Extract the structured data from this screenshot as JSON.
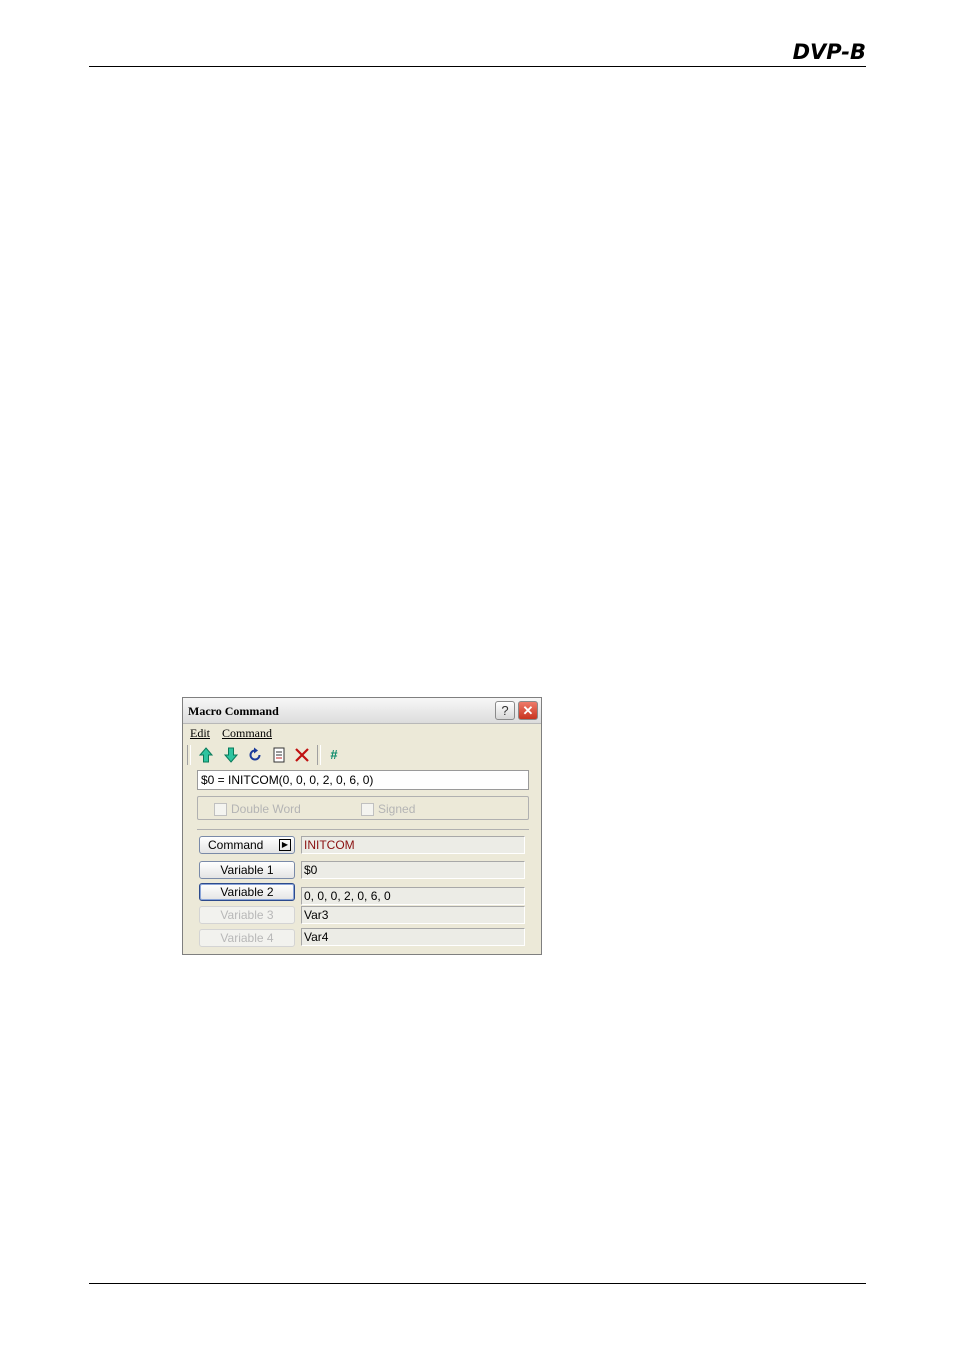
{
  "header": {
    "logo_text": "DVP-B"
  },
  "dialog": {
    "title": "Macro Command",
    "help_glyph": "?",
    "close_glyph": "✕",
    "menu": {
      "edit": "Edit",
      "command": "Command"
    },
    "toolbar": {
      "icons": [
        "arrow-up-icon",
        "arrow-down-icon",
        "refresh-icon",
        "document-icon",
        "delete-icon",
        "hash-icon"
      ],
      "hash_label": "#"
    },
    "expression": "$0 = INITCOM(0, 0, 0, 2, 0, 6, 0)",
    "options": {
      "double_word": "Double Word",
      "signed": "Signed"
    },
    "params": {
      "command_label": "Command",
      "command_value": "INITCOM",
      "var1_label": "Variable 1",
      "var1_value": "$0",
      "var2_label": "Variable 2",
      "var2_value": "0, 0, 0, 2, 0, 6, 0",
      "var3_label": "Variable 3",
      "var3_value": "Var3",
      "var4_label": "Variable 4",
      "var4_value": "Var4"
    },
    "colors": {
      "command_value": "#8a1010",
      "toolbar_arrows": "#0a8a6a",
      "delete": "#c01010"
    }
  }
}
